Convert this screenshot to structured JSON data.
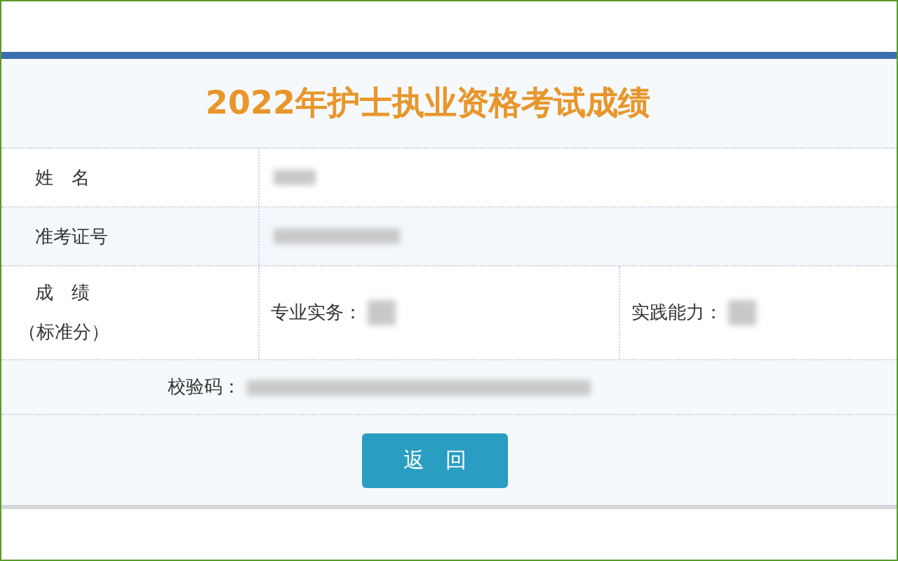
{
  "title": "2022年护士执业资格考试成绩",
  "rows": [
    {
      "kind": "single",
      "label": "姓　名"
    },
    {
      "kind": "single",
      "label": "准考证号"
    },
    {
      "kind": "scores",
      "label": "成　绩",
      "sublabel": "（标准分）",
      "scores": [
        {
          "label": "专业实务："
        },
        {
          "label": "实践能力："
        }
      ]
    }
  ],
  "verification": {
    "label": "校验码："
  },
  "button": "返　回"
}
